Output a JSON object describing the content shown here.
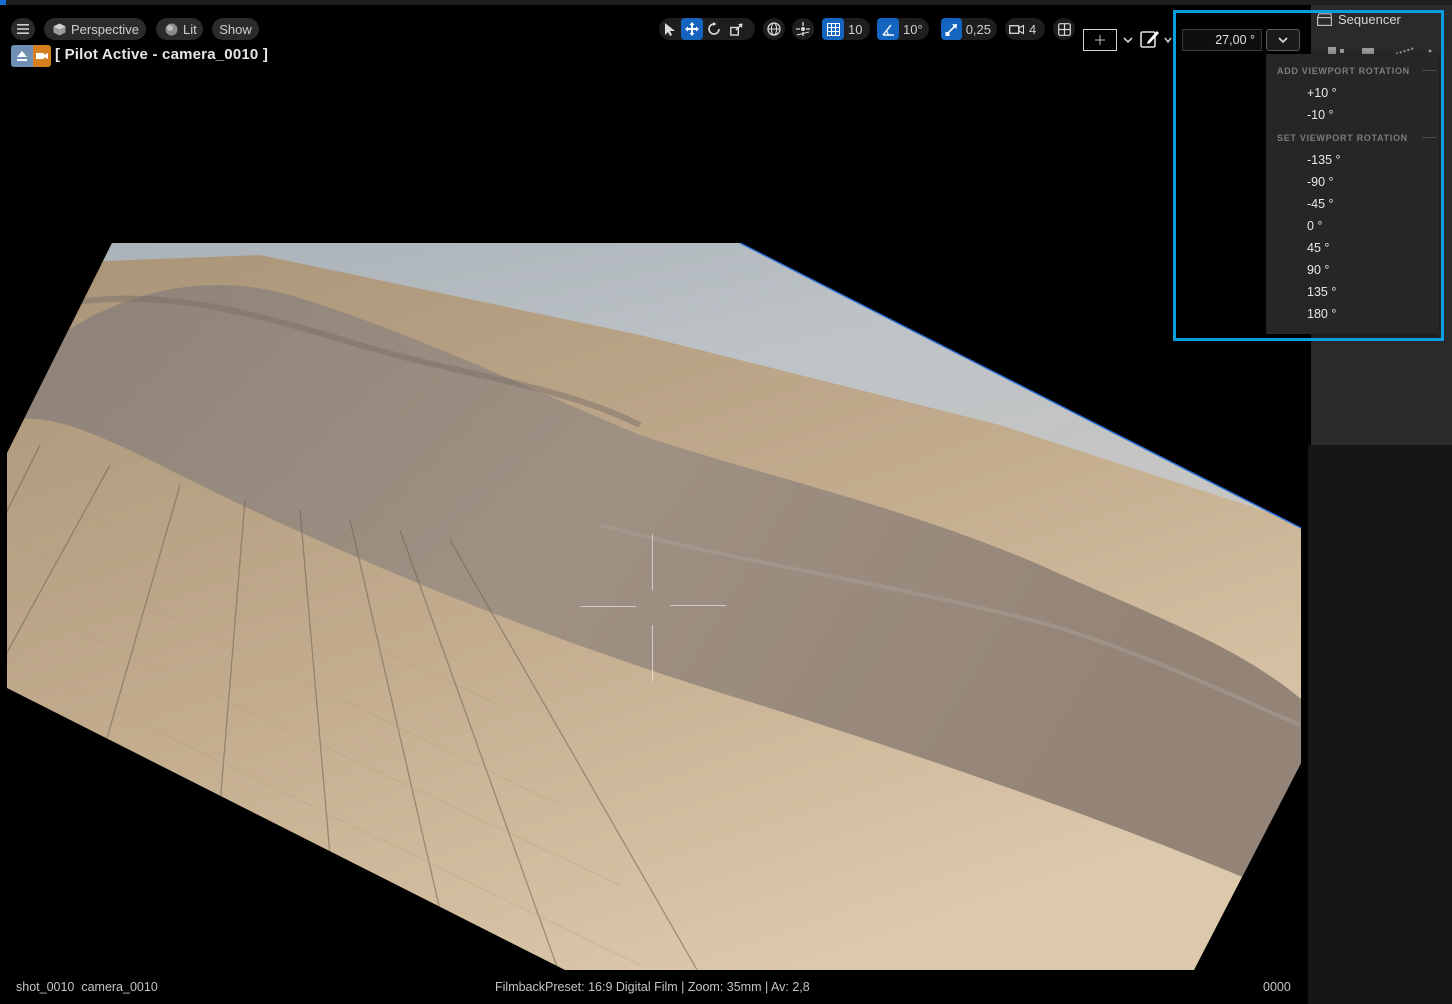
{
  "toolbar": {
    "view_mode": "Perspective",
    "lighting": "Lit",
    "show": "Show",
    "grid_snap_value": "10",
    "rotation_snap_value": "10°",
    "scale_snap_value": "0,25",
    "camera_speed_value": "4"
  },
  "pilot": {
    "label": "[ Pilot Active - camera_0010 ]"
  },
  "status": {
    "left": "shot_0010  camera_0010",
    "center": "FilmbackPreset: 16:9 Digital Film | Zoom: 35mm | Av: 2,8",
    "right": "0000"
  },
  "sequencer": {
    "title": "Sequencer"
  },
  "rotation": {
    "value": "27,00 °",
    "add_section": "ADD VIEWPORT ROTATION",
    "add_items": [
      "+10 °",
      "-10 °"
    ],
    "set_section": "SET VIEWPORT ROTATION",
    "set_items": [
      "-135 °",
      "-90 °",
      "-45 °",
      "0 °",
      "45 °",
      "90 °",
      "135 °",
      "180 °"
    ]
  },
  "colors": {
    "accent": "#1565c0",
    "highlight": "#0a9ee0",
    "sky": "#b8c0c6",
    "sand": "#c9b295",
    "dunes": "#8f8478"
  },
  "icons": {
    "hamburger": "hamburger-icon",
    "perspective": "cube-icon",
    "lit": "lit-sphere-icon",
    "select": "select-arrow-icon",
    "translate": "translate-icon",
    "rotate": "rotate-icon",
    "scale": "scale-icon",
    "world": "globe-icon",
    "surface_snap": "surface-snap-icon",
    "grid_snap": "grid-snap-icon",
    "rotation_snap": "angle-snap-icon",
    "scale_snap": "scale-snap-icon",
    "camera_speed": "camera-speed-icon",
    "layout": "layout-icon",
    "pilot": "pilot-eject-icon",
    "camera": "camera-icon",
    "edit": "edit-pencil-icon",
    "chevron": "chevron-down-icon",
    "clapper": "clapperboard-icon"
  }
}
